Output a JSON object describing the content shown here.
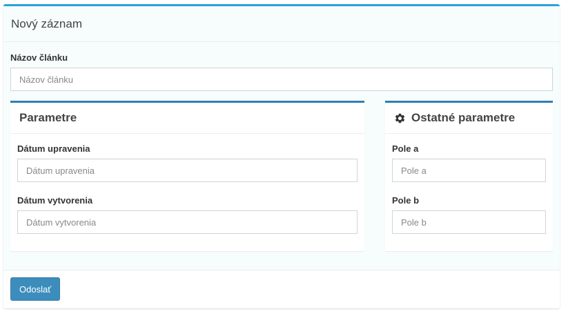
{
  "main": {
    "title": "Nový záznam"
  },
  "article_title": {
    "label": "Názov článku",
    "placeholder": "Názov článku",
    "value": ""
  },
  "params_box": {
    "title": "Parametre",
    "fields": [
      {
        "label": "Dátum upravenia",
        "placeholder": "Dátum upravenia",
        "value": ""
      },
      {
        "label": "Dátum vytvorenia",
        "placeholder": "Dátum vytvorenia",
        "value": ""
      }
    ]
  },
  "other_box": {
    "title": "Ostatné parametre",
    "icon": "gear-icon",
    "fields": [
      {
        "label": "Pole a",
        "placeholder": "Pole a",
        "value": ""
      },
      {
        "label": "Pole b",
        "placeholder": "Pole b",
        "value": ""
      }
    ]
  },
  "footer": {
    "submit_label": "Odoslať"
  },
  "colors": {
    "accent": "#27a3d8",
    "box_border": "#2d7fb3",
    "button": "#3c8dbc"
  }
}
